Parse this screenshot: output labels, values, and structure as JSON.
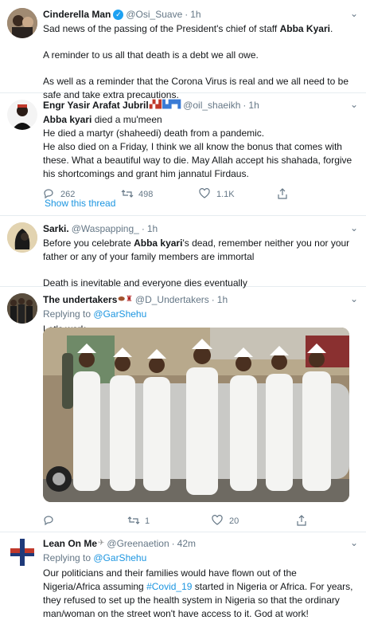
{
  "tweets": [
    {
      "name": "Cinderella Man",
      "handle": "@Osi_Suave",
      "time": "1h",
      "line1_pre": "Sad news of the passing of the President's chief of staff ",
      "line1_bold": "Abba Kyari",
      "line1_post": ".",
      "para2": "A reminder to us all that death is a debt we all owe.",
      "para3": "As well as a reminder that the Corona Virus is real and we all need to be safe and take extra precautions."
    },
    {
      "name": "Engr Yasir Arafat Jubril",
      "handle": "@oil_shaeikh",
      "time": "1h",
      "line1_bold": "Abba kyari",
      "line1_post": " died a mu'meen",
      "line2": "He died a martyr (shaheedi) death from a pandemic.",
      "line3": "He also died on a Friday, I think we all know the bonus that comes with these. What a beautiful way to die. May Allah accept his shahada, forgive his shortcomings and grant him jannatul Firdaus.",
      "replies": "262",
      "retweets": "498",
      "likes": "1.1K"
    },
    {
      "show_thread": "Show this thread"
    },
    {
      "name": "Sarki.",
      "handle": "@Waspapping_",
      "time": "1h",
      "line1_pre": "Before you celebrate ",
      "line1_bold": "Abba kyari",
      "line1_post": "'s dead, remember neither you nor your father or any of your family members are immortal",
      "para2": "Death is inevitable and everyone dies eventually"
    },
    {
      "name": "The undertakers",
      "handle": "@D_Undertakers",
      "time": "1h",
      "replying_prefix": "Replying to ",
      "replying_to": "@GarShehu",
      "text": "Let's work",
      "retweets": "1",
      "likes": "20"
    },
    {
      "name": "Lean On Me",
      "handle": "@Greenaetion",
      "time": "42m",
      "replying_prefix": "Replying to ",
      "replying_to": "@GarShehu",
      "text_pre": "Our politicians and their families would have flown out of the Nigeria/Africa assuming ",
      "hashtag": "#Covid_19",
      "text_post": " started in Nigeria or Africa. For years, they refused to set up the health system in Nigeria so that the ordinary man/woman on the street won't have access to it. God at work!"
    }
  ],
  "icons": [
    "verified-icon",
    "caret-down-icon",
    "reply-icon",
    "retweet-icon",
    "like-icon",
    "share-icon"
  ],
  "colors": {
    "link": "#1b95e0",
    "secondary": "#657786",
    "verified": "#1da1f2",
    "divider": "#e6ecf0"
  }
}
